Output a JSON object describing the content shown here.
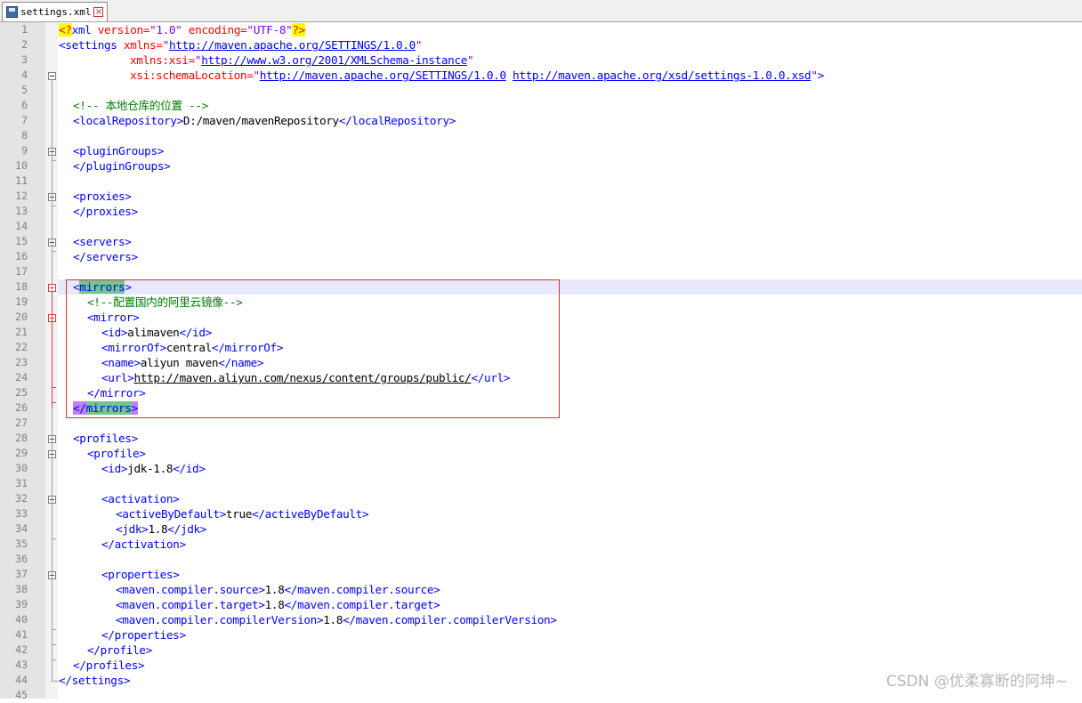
{
  "tab": {
    "filename": "settings.xml",
    "save_icon": "save-icon",
    "close_icon": "close-icon"
  },
  "line_numbers": [
    "1",
    "2",
    "3",
    "4",
    "5",
    "6",
    "7",
    "8",
    "9",
    "10",
    "11",
    "12",
    "13",
    "14",
    "15",
    "16",
    "17",
    "18",
    "19",
    "20",
    "21",
    "22",
    "23",
    "24",
    "25",
    "26",
    "27",
    "28",
    "29",
    "30",
    "31",
    "32",
    "33",
    "34",
    "35",
    "36",
    "37",
    "38",
    "39",
    "40",
    "41",
    "42",
    "43",
    "44",
    "45"
  ],
  "code": {
    "l1_pi_open": "<?",
    "l1_xml": "xml",
    "l1_attr1": " version=",
    "l1_val1": "\"1.0\"",
    "l1_attr2": " encoding=",
    "l1_val2": "\"UTF-8\"",
    "l1_pi_close": "?>",
    "l2_tag": "<settings",
    "l2_attr": " xmlns=",
    "l2_q1": "\"",
    "l2_url": "http://maven.apache.org/SETTINGS/1.0.0",
    "l2_q2": "\"",
    "l3_attr": "xmlns:xsi=",
    "l3_q1": "\"",
    "l3_url": "http://www.w3.org/2001/XMLSchema-instance",
    "l3_q2": "\"",
    "l4_attr": "xsi:schemaLocation=",
    "l4_q1": "\"",
    "l4_url1": "http://maven.apache.org/SETTINGS/1.0.0",
    "l4_url2": "http://maven.apache.org/xsd/settings-1.0.0.xsd",
    "l4_q2": "\"",
    "l4_end": ">",
    "l6_comment": "<!-- 本地仓库的位置 -->",
    "l7_open": "<localRepository>",
    "l7_text": "D:/maven/mavenRepository",
    "l7_close": "</localRepository>",
    "l9": "<pluginGroups>",
    "l10": "</pluginGroups>",
    "l12": "<proxies>",
    "l13": "</proxies>",
    "l15": "<servers>",
    "l16": "</servers>",
    "l18_lt": "<",
    "l18_name": "mirrors",
    "l18_gt": ">",
    "l19_comment": "<!--配置国内的阿里云镜像-->",
    "l20": "<mirror>",
    "l21_open": "<id>",
    "l21_text": "alimaven",
    "l21_close": "</id>",
    "l22_open": "<mirrorOf>",
    "l22_text": "central",
    "l22_close": "</mirrorOf>",
    "l23_open": "<name>",
    "l23_text": "aliyun maven",
    "l23_close": "</name>",
    "l24_open": "<url>",
    "l24_text": "http://maven.aliyun.com/nexus/content/groups/public/",
    "l24_close": "</url>",
    "l25": "</mirror>",
    "l26_lt": "</",
    "l26_name": "mirrors",
    "l26_gt": ">",
    "l28": "<profiles>",
    "l29": "<profile>",
    "l30_open": "<id>",
    "l30_text": "jdk-1.8",
    "l30_close": "</id>",
    "l32": "<activation>",
    "l33_open": "<activeByDefault>",
    "l33_text": "true",
    "l33_close": "</activeByDefault>",
    "l34_open": "<jdk>",
    "l34_text": "1.8",
    "l34_close": "</jdk>",
    "l35": "</activation>",
    "l37": "<properties>",
    "l38_open": "<maven.compiler.source>",
    "l38_text": "1.8",
    "l38_close": "</maven.compiler.source>",
    "l39_open": "<maven.compiler.target>",
    "l39_text": "1.8",
    "l39_close": "</maven.compiler.target>",
    "l40_open": "<maven.compiler.compilerVersion>",
    "l40_text": "1.8",
    "l40_close": "</maven.compiler.compilerVersion>",
    "l41": "</properties>",
    "l42": "</profile>",
    "l43": "</profiles>",
    "l44": "</settings>"
  },
  "watermark": "CSDN @优柔寡断的阿坤~",
  "colors": {
    "tag": "#0000ff",
    "attribute": "#ff0000",
    "value": "#8000ff",
    "comment": "#008000",
    "current_line": "#e8e8ff",
    "annotation_box": "#e03030"
  }
}
